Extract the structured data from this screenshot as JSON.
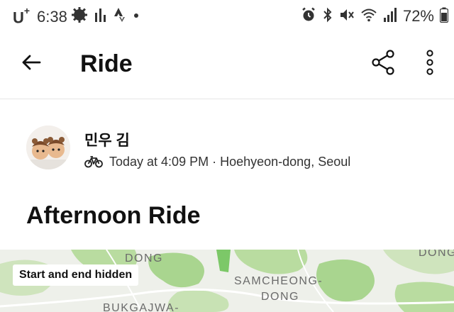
{
  "status_bar": {
    "carrier": "U",
    "carrier_sup": "+",
    "time": "6:38",
    "battery": "72%",
    "icons": [
      "settings-gear-icon",
      "equalizer-icon",
      "strava-icon",
      "notification-dot-icon",
      "alarm-icon",
      "bluetooth-icon",
      "mute-icon",
      "wifi-icon",
      "signal-icon",
      "battery-icon"
    ]
  },
  "app_bar": {
    "title": "Ride"
  },
  "athlete": {
    "name": "민우 김",
    "time": "Today at 4:09 PM",
    "separator": "·",
    "location": "Hoehyeon-dong, Seoul"
  },
  "activity": {
    "title": "Afternoon Ride"
  },
  "map": {
    "badge": "Start and end hidden",
    "labels": {
      "dong_top": "DONG",
      "dong_right": "DONG",
      "samcheong": "SAMCHEONG-",
      "samcheong_dong": "DONG",
      "bukgajwa": "BUKGAJWA-"
    }
  },
  "colors": {
    "text": "#111111",
    "map_bg": "#eef0ea",
    "map_green": "#a9d58f",
    "map_green_dark": "#7cc868"
  }
}
